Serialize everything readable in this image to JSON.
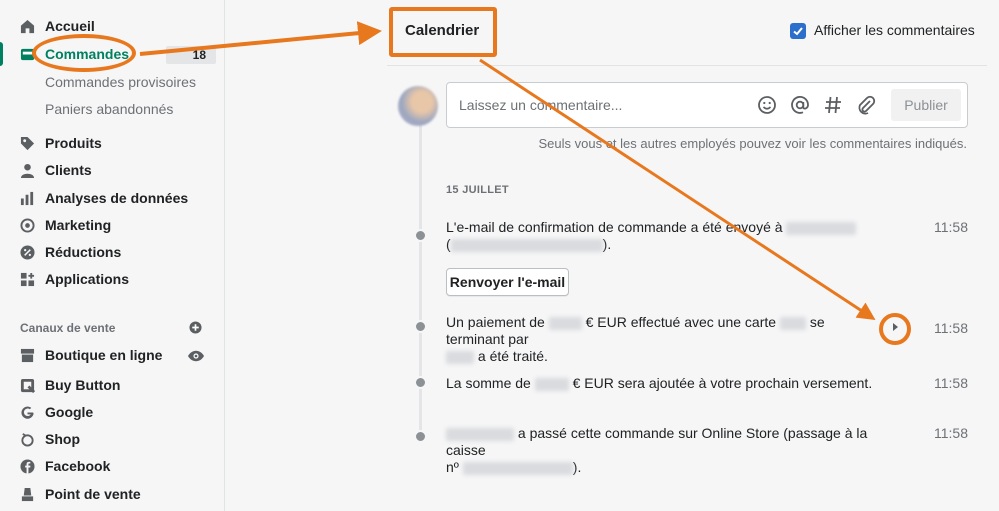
{
  "sidebar": {
    "items": [
      {
        "label": "Accueil",
        "icon": "home-icon"
      },
      {
        "label": "Commandes",
        "icon": "orders-icon",
        "badge": "18"
      },
      {
        "label": "Produits",
        "icon": "tag-icon"
      },
      {
        "label": "Clients",
        "icon": "person-icon"
      },
      {
        "label": "Analyses de données",
        "icon": "bar-chart-icon"
      },
      {
        "label": "Marketing",
        "icon": "target-icon"
      },
      {
        "label": "Réductions",
        "icon": "discount-icon"
      },
      {
        "label": "Applications",
        "icon": "apps-icon"
      }
    ],
    "sub_items": [
      "Commandes provisoires",
      "Paniers abandonnés"
    ],
    "channels_title": "Canaux de vente",
    "channels": [
      {
        "label": "Boutique en ligne",
        "icon": "store-icon"
      },
      {
        "label": "Buy Button",
        "icon": "buy-button-icon"
      },
      {
        "label": "Google",
        "icon": "google-icon"
      },
      {
        "label": "Shop",
        "icon": "shop-icon"
      },
      {
        "label": "Facebook",
        "icon": "facebook-icon"
      },
      {
        "label": "Point de vente",
        "icon": "pos-icon"
      }
    ]
  },
  "main": {
    "title": "Calendrier",
    "show_comments_label": "Afficher les commentaires",
    "comment_placeholder": "Laissez un commentaire...",
    "publish_label": "Publier",
    "hint": "Seuls vous et les autres employés pouvez voir les commentaires indiqués.",
    "date": "15 JUILLET",
    "events": [
      {
        "before": "L'e-mail de confirmation de commande a été envoyé à",
        "after": "",
        "line2_after": ").",
        "time": "11:58"
      },
      {
        "before": "Un paiement de",
        "middle": "€ EUR effectué avec une carte",
        "after": "se terminant par",
        "line2_after": "a été traité.",
        "time": "11:58"
      },
      {
        "before": "La somme de",
        "after": "€ EUR sera ajoutée à votre prochain versement.",
        "time": "11:58"
      },
      {
        "before": "",
        "after": "a passé cette commande sur Online Store (passage à la caisse",
        "line2_prefix": "nº",
        "line2_after": ").",
        "time": "11:58"
      }
    ],
    "resend_label": "Renvoyer l'e-mail"
  },
  "colors": {
    "accent": "#008060",
    "annotation": "#e8781e",
    "checkbox": "#2c6ecb"
  }
}
